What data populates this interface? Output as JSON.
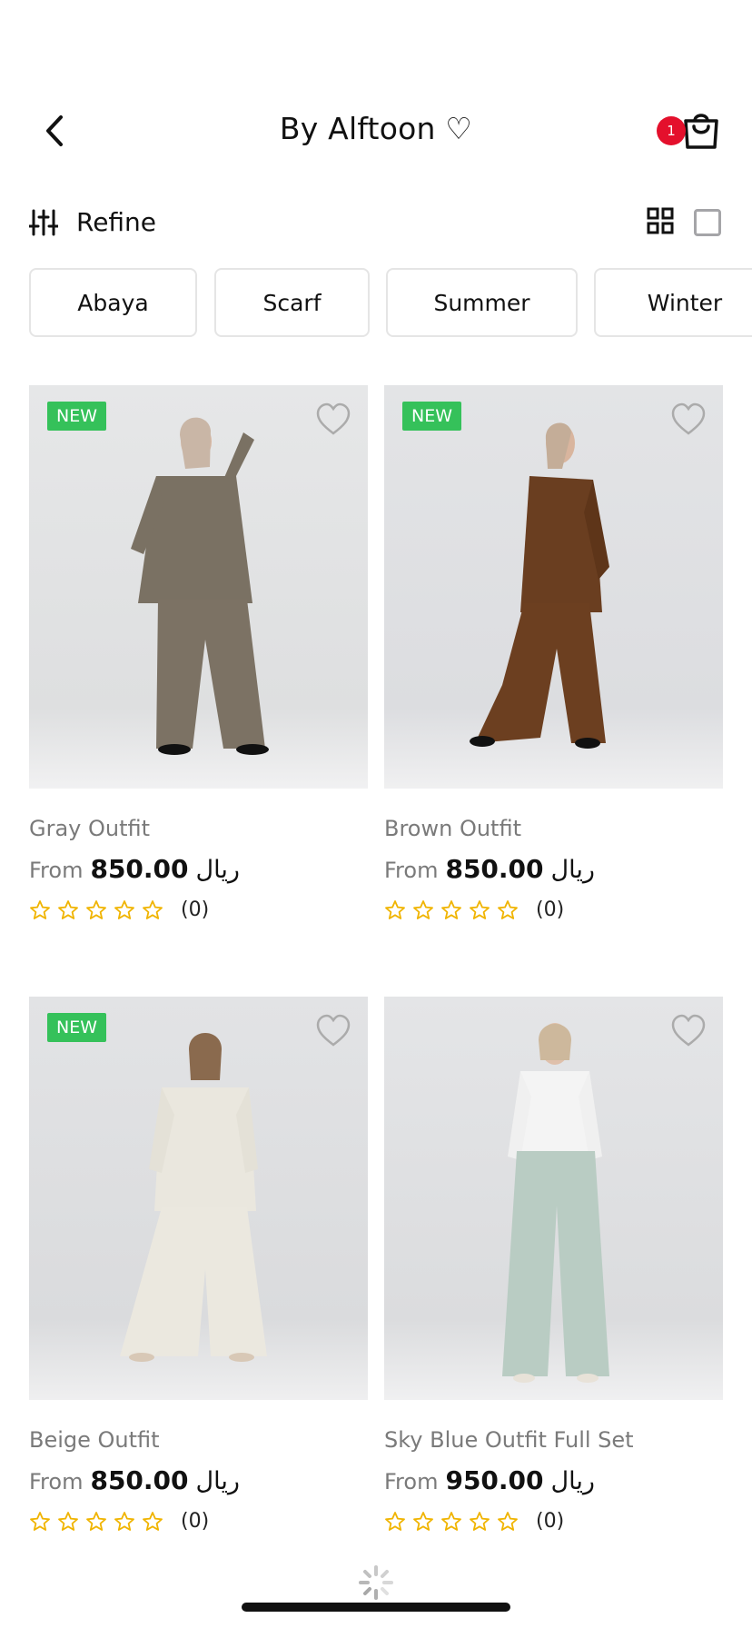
{
  "header": {
    "title": "By Alftoon ♡",
    "cart_count": "1"
  },
  "toolbar": {
    "refine_label": "Refine"
  },
  "chips": [
    "Abaya",
    "Scarf",
    "Summer",
    "Winter"
  ],
  "products": [
    {
      "name": "Gray Outfit",
      "from": "From",
      "price": "850.00",
      "currency": "ريال",
      "is_new": true,
      "badge": "NEW",
      "rating_count": "(0)",
      "rating": 0
    },
    {
      "name": "Brown Outfit",
      "from": "From",
      "price": "850.00",
      "currency": "ريال",
      "is_new": true,
      "badge": "NEW",
      "rating_count": "(0)",
      "rating": 0
    },
    {
      "name": "Beige Outfit",
      "from": "From",
      "price": "850.00",
      "currency": "ريال",
      "is_new": true,
      "badge": "NEW",
      "rating_count": "(0)",
      "rating": 0
    },
    {
      "name": "Sky Blue Outfit Full Set",
      "from": "From",
      "price": "950.00",
      "currency": "ريال",
      "is_new": false,
      "badge": "",
      "rating_count": "(0)",
      "rating": 0
    }
  ],
  "colors": {
    "badge_new": "#35c15a",
    "cart_badge": "#e4102c",
    "star": "#f0b400"
  },
  "icons": {
    "back": "chevron-left-icon",
    "cart": "shopping-bag-icon",
    "refine": "sliders-icon",
    "grid": "grid-view-icon",
    "list": "single-view-icon",
    "favorite": "heart-outline-icon",
    "star": "star-outline-icon",
    "loading": "spinner-icon"
  }
}
